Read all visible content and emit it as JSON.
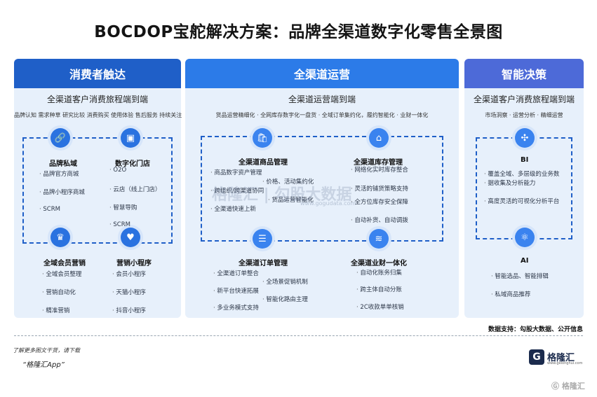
{
  "title": "BOCDOP宝舵解决方案：品牌全渠道数字化零售全景图",
  "panels": {
    "left": {
      "header": "消费者触达",
      "subtitle": "全渠道客户消费旅程端到端",
      "tagline": "品牌认知  需求种草  研究比较  消费购买  使用体验  售后服务  持续关注",
      "modules": [
        {
          "title": "品牌私域",
          "icon": "link-icon",
          "items": [
            "品牌官方商城",
            "品牌小程序商城",
            "SCRM"
          ]
        },
        {
          "title": "数字化门店",
          "icon": "store-icon",
          "items": [
            "O2O",
            "云店（线上门店）",
            "智慧导购",
            "SCRM"
          ]
        },
        {
          "title": "全域会员营销",
          "icon": "crown-icon",
          "items": [
            "全域会员整理",
            "营销自动化",
            "精准营销"
          ]
        },
        {
          "title": "营销小程序",
          "icon": "heart-icon",
          "items": [
            "会员小程序",
            "天猫小程序",
            "抖音小程序"
          ]
        }
      ]
    },
    "middle": {
      "header": "全渠道运营",
      "subtitle": "全渠道运营端到端",
      "tagline": "货品运营精细化 · 全网库存数字化一盘货 · 全域订单集约化，履约智能化 · 业财一体化",
      "modules": [
        {
          "title": "全渠道商品管理",
          "icon": "bag-icon",
          "items_a": [
            "商品数字资产管理",
            "跨组织/跨渠道协同",
            "全渠道快速上新"
          ],
          "items_b": [
            "价格、活动集约化",
            "货品运营智能化"
          ]
        },
        {
          "title": "全渠道库存管理",
          "icon": "warehouse-icon",
          "items": [
            "网络化实时库存整合",
            "灵活的铺货策略支持",
            "全方位库存安全保障",
            "自动补货、自动调拨"
          ]
        },
        {
          "title": "全渠道订单管理",
          "icon": "order-icon",
          "items_a": [
            "全渠道订单整合",
            "新平台快速拓展",
            "多业务模式支持"
          ],
          "items_b": [
            "全场景促销机制",
            "智能化路由主理"
          ]
        },
        {
          "title": "全渠道业财一体化",
          "icon": "layers-icon",
          "items": [
            "自动化账务归集",
            "跨主体自动分账",
            "2C收款单单核销"
          ]
        }
      ]
    },
    "right": {
      "header": "智能决策",
      "subtitle": "全渠道客户消费旅程端到端",
      "tagline": "市场洞察  · 运营分析  · 精细运营",
      "modules": [
        {
          "title": "BI",
          "icon": "network-icon",
          "items": [
            "覆盖全域、多层级的业务数",
            "据收集及分析能力",
            "高度灵活的可视化分析平台"
          ]
        },
        {
          "title": "AI",
          "icon": "atom-icon",
          "items": [
            "智能选品、智能排辑",
            "私域商品推荐"
          ]
        }
      ]
    }
  },
  "watermark": {
    "text": "格隆汇 | 勾股大数据",
    "url": "www.gogudata.com"
  },
  "source": "数据支持：勾股大数据、公开信息",
  "more_note": "了解更多图文干货，请下载",
  "app_name": "“格隆汇App”",
  "logo": {
    "mark": "G",
    "name": "格隆汇",
    "sub": "www.gelonghui.com"
  },
  "bottom_watermark": "Ⓖ 格隆汇",
  "colors": {
    "header_left": "#1f5fc8",
    "header_middle": "#2c7be8",
    "header_right": "#4d6ad8",
    "panel_bg": "#e7f0fb",
    "dashed_line": "#1f5fc8"
  }
}
